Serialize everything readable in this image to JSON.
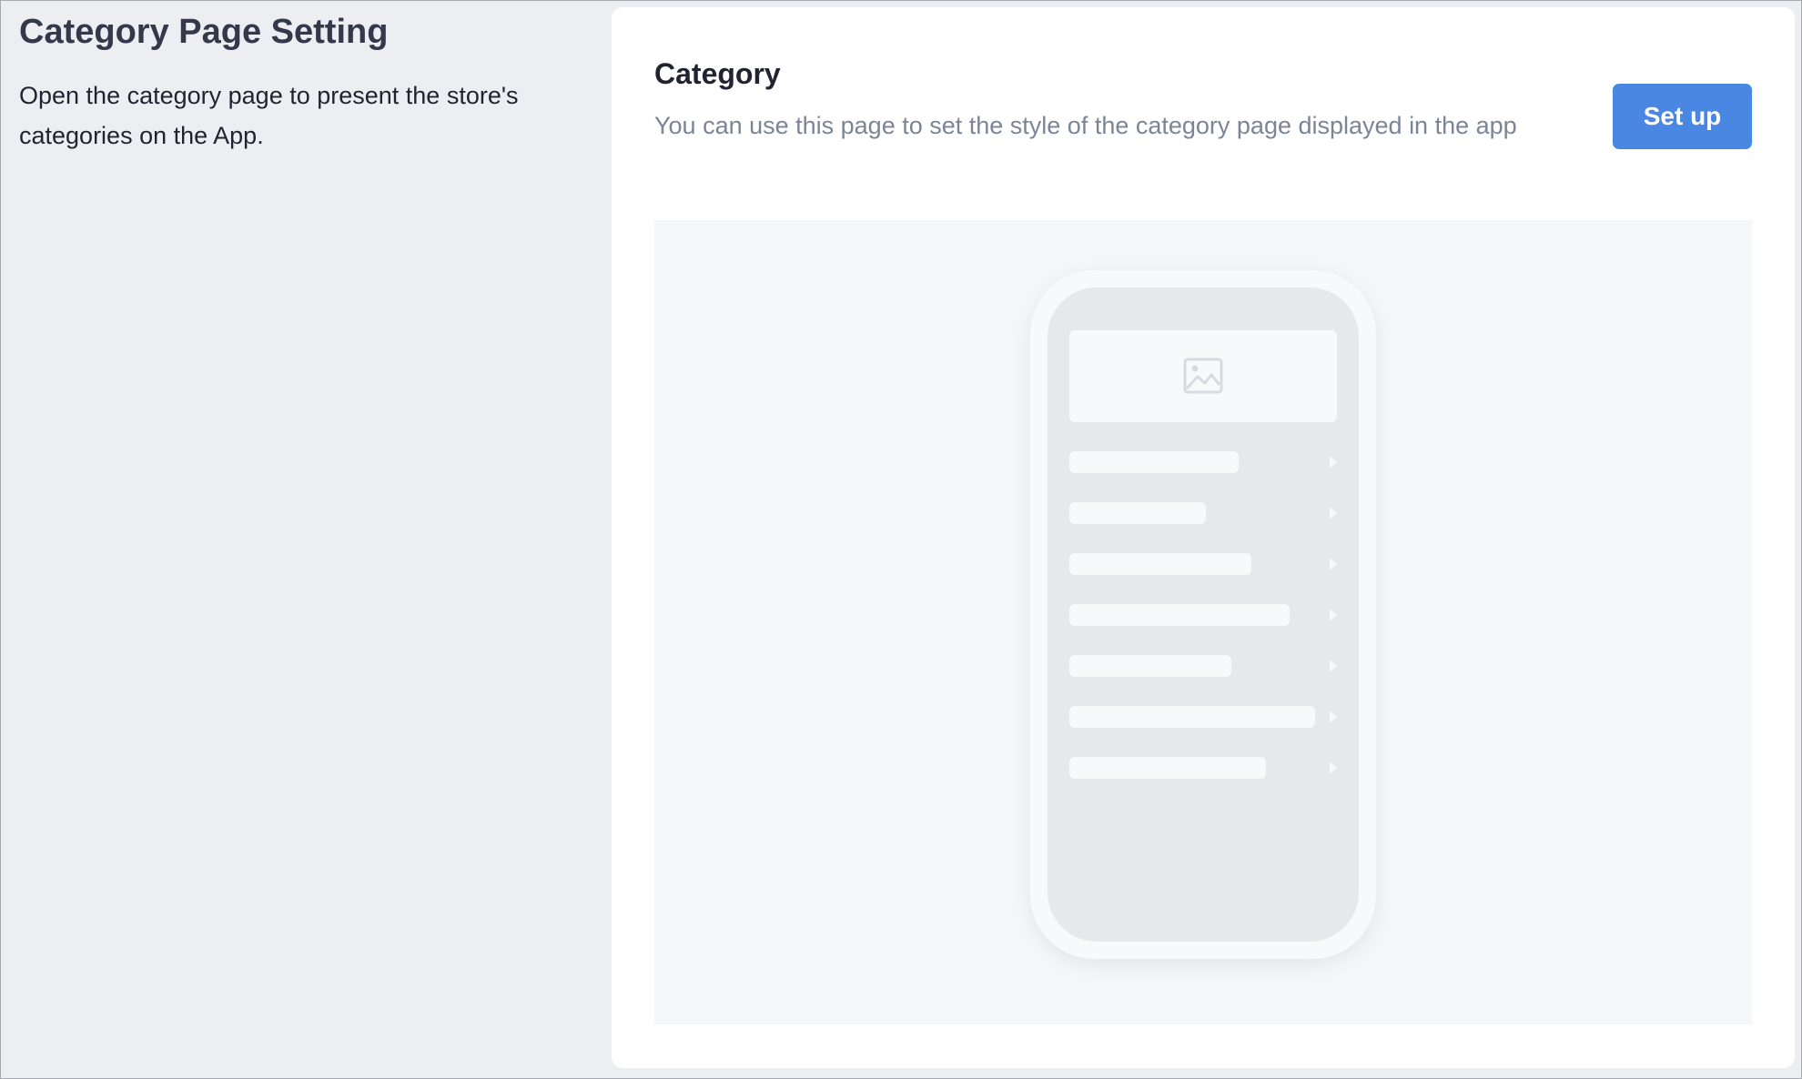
{
  "section": {
    "title": "Category Page Setting",
    "description": "Open the category page to present the store's categories on the App."
  },
  "card": {
    "title": "Category",
    "description": "You can use this page to set the style of the category page displayed in the app",
    "setup_label": "Set up"
  },
  "preview": {
    "banner_icon": "image-placeholder-icon",
    "rows": 7
  },
  "colors": {
    "accent": "#4a87e3",
    "page_bg": "#eceef1",
    "card_bg": "#ffffff",
    "preview_bg": "#f5f6f7",
    "phone_screen": "#e6e8ec",
    "placeholder": "#f8f9fa"
  }
}
